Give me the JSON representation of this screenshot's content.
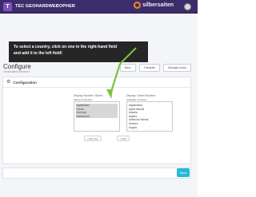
{
  "header": {
    "app_title": "TEC GEOHARDWEBOPHER",
    "brand_name": "silbersaiten",
    "brand_color": "#f08a1c",
    "background_color": "#3d2c6b"
  },
  "tooltip": {
    "line1": "To select a country, click on one in the right-hand field",
    "line2": "and add it to the left field!"
  },
  "toolbar": {
    "buttons": [
      "Back",
      "Translate",
      "Manage hooks"
    ]
  },
  "page": {
    "title": "Configure",
    "subtitle": "Geolocation Redirect"
  },
  "panel": {
    "title": "Configuration",
    "left_heading": "Display Number: Street",
    "left_sublabel": "Allowed countries",
    "right_heading": "Display: Street Number",
    "right_sublabel": "Available countries",
    "left_items": [
      {
        "label": "Afghanistan",
        "selected": true
      },
      {
        "label": "France",
        "selected": true
      },
      {
        "label": "Germany",
        "selected": true
      },
      {
        "label": "Switzerland",
        "selected": true
      }
    ],
    "right_items": [
      {
        "label": "Afghanistan"
      },
      {
        "label": "Aland Islands"
      },
      {
        "label": "Albania"
      },
      {
        "label": "Algeria"
      },
      {
        "label": "American Samoa"
      },
      {
        "label": "Andorra"
      },
      {
        "label": "Angola"
      }
    ],
    "remove_label": "« Remove",
    "add_label": "« Add"
  },
  "footer": {
    "save_label": "Save",
    "save_color": "#25b9d7"
  }
}
